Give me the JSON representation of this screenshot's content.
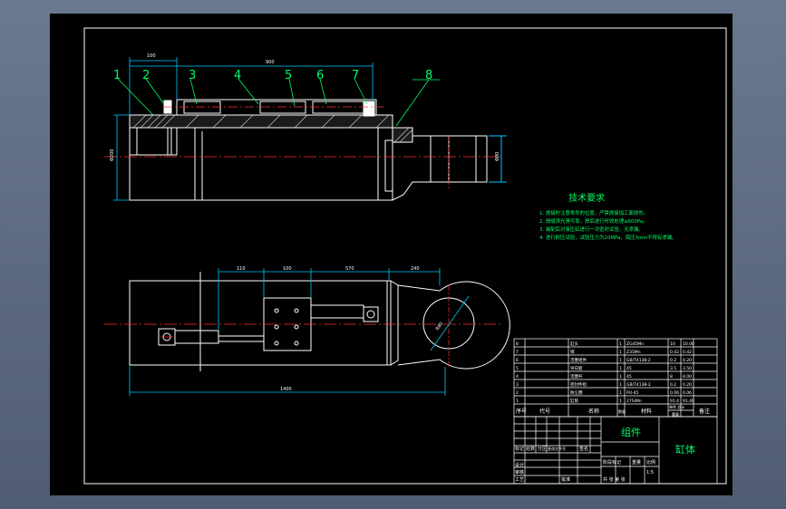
{
  "drawing": {
    "part_numbers": [
      "1",
      "2",
      "3",
      "4",
      "5",
      "6",
      "7",
      "8"
    ],
    "dims_top": {
      "d1": "100",
      "d2": "900",
      "left": "Φ200",
      "right": "Φ80"
    },
    "dims_bottom": {
      "d1": "110",
      "d2": "100",
      "d3": "570",
      "d4": "240",
      "total": "1400",
      "radius": "R80"
    }
  },
  "tech_requirements": {
    "title": "技术要求",
    "items": [
      "1. 焊接时注意零件的位置，严禁焊接加工面损伤。",
      "2. 焊缝须光滑可靠，焊后进行时效处理≤600Pa。",
      "3. 装配后对液压缸进行一次密封试验，无渗漏。",
      "4. 进行耐压试验，试验压力为20MPa，保压3min不得有渗漏。"
    ]
  },
  "bom": {
    "rows": [
      {
        "no": "8",
        "name": "缸头",
        "qty": "1",
        "material": "ZG45Mn",
        "w1": "10",
        "w2": "10.00"
      },
      {
        "no": "7",
        "name": "销",
        "qty": "1",
        "material": "Z35Mn",
        "w1": "0.42",
        "w2": "0.42"
      },
      {
        "no": "6",
        "name": "活塞组件",
        "qty": "1",
        "material": "GB/T4138-2",
        "w1": "0.2",
        "w2": "0.20"
      },
      {
        "no": "5",
        "name": "导向套",
        "qty": "1",
        "material": "45",
        "w1": "3.5",
        "w2": "3.50"
      },
      {
        "no": "4",
        "name": "活塞杆",
        "qty": "1",
        "material": "45",
        "w1": "8",
        "w2": "8.00"
      },
      {
        "no": "3",
        "name": "密封件组",
        "qty": "1",
        "material": "GB/T4138-2",
        "w1": "0.2",
        "w2": "0.20"
      },
      {
        "no": "2",
        "name": "防尘圈",
        "qty": "1",
        "material": "PU-45",
        "w1": "0.06",
        "w2": "0.06"
      },
      {
        "no": "1",
        "name": "缸筒",
        "qty": "1",
        "material": "27SiMn",
        "w1": "91.4",
        "w2": "91.40"
      }
    ],
    "header": {
      "no": "序号",
      "code": "代号",
      "name": "名称",
      "qty": "数量",
      "material": "材料",
      "weight": "单件 总计",
      "weight_label": "重量",
      "remark": "备注"
    }
  },
  "title_block": {
    "assembly": "组件",
    "part_name": "缸体",
    "scale": "1:5",
    "labels": [
      "设计",
      "审核",
      "工艺",
      "批准",
      "标记",
      "处数",
      "分区",
      "更改文件号",
      "签名",
      "年月日",
      "阶段标记",
      "重量",
      "比例",
      "共 张 第 张"
    ]
  }
}
